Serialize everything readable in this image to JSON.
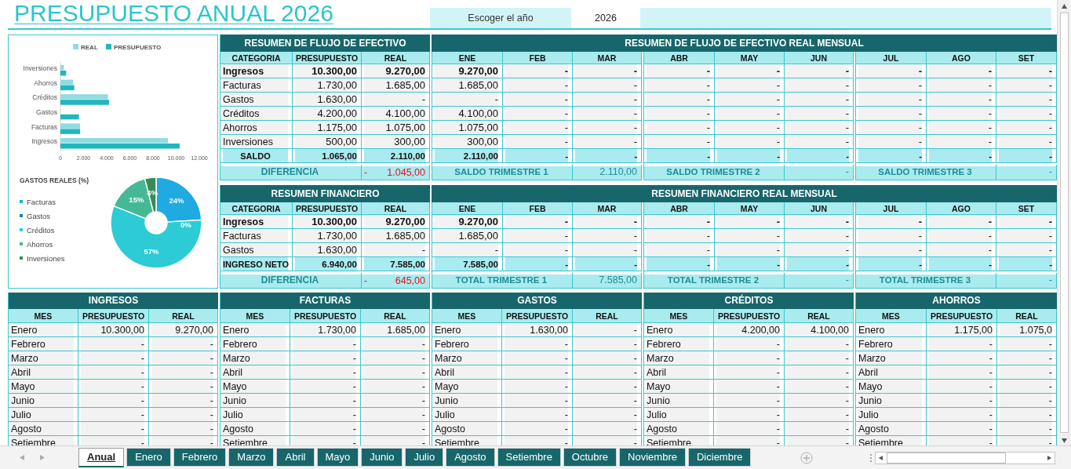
{
  "title": "PRESUPUESTO ANUAL 2026",
  "year_picker": {
    "label": "Escoger el año",
    "value": "2026"
  },
  "bar_chart": {
    "chart_data": {
      "type": "bar",
      "orientation": "horizontal",
      "legend": "top",
      "categories": [
        "Inversiones",
        "Ahorros",
        "Créditos",
        "Gastos",
        "Facturas",
        "Ingresos"
      ],
      "series": [
        {
          "name": "REAL",
          "color": "#8edde1",
          "values": [
            300,
            1100,
            4100,
            0,
            1700,
            9300
          ]
        },
        {
          "name": "PRESUPUESTO",
          "color": "#22b6bd",
          "values": [
            500,
            1200,
            4200,
            1600,
            1700,
            10300
          ]
        }
      ],
      "xlim": [
        0,
        12000
      ],
      "xticks": [
        {
          "value": 0,
          "label": "0"
        },
        {
          "value": 2000,
          "label": "2.000"
        },
        {
          "value": 4000,
          "label": "4.000"
        },
        {
          "value": 6000,
          "label": "6.000"
        },
        {
          "value": 8000,
          "label": "8.000"
        },
        {
          "value": 10000,
          "label": "10.000"
        },
        {
          "value": 12000,
          "label": "12.000"
        }
      ]
    }
  },
  "donut_chart": {
    "chart_data": {
      "type": "donut",
      "title": "GASTOS REALES (%)",
      "categories": [
        "Facturas",
        "Gastos",
        "Créditos",
        "Ahorros",
        "Inversiones"
      ],
      "values": [
        24,
        0,
        57,
        15,
        4
      ],
      "value_labels": [
        "24%",
        "0%",
        "57%",
        "15%",
        "4%"
      ]
    },
    "legend": [
      {
        "color": "#1faae2"
      },
      {
        "color": "#1e7db8"
      },
      {
        "color": "#2ccbd6"
      },
      {
        "color": "#45b996"
      },
      {
        "color": "#3a8a55"
      }
    ]
  },
  "cash_flow_summary": {
    "title": "RESUMEN DE FLUJO DE EFECTIVO",
    "columns": [
      "CATEGORIA",
      "PRESUPUESTO",
      "REAL"
    ],
    "rows": [
      {
        "kind": "income",
        "category": "Ingresos",
        "budget": "10.300,00",
        "real": "9.270,00"
      },
      {
        "kind": "item",
        "category": "Facturas",
        "budget": "1.730,00",
        "real": "1.685,00"
      },
      {
        "kind": "item",
        "category": "Gastos",
        "budget": "1.630,00",
        "real": "-"
      },
      {
        "kind": "item",
        "category": "Créditos",
        "budget": "4.200,00",
        "real": "4.100,00"
      },
      {
        "kind": "item",
        "category": "Ahorros",
        "budget": "1.175,00",
        "real": "1.075,00"
      },
      {
        "kind": "item",
        "category": "Inversiones",
        "budget": "500,00",
        "real": "300,00"
      },
      {
        "kind": "total",
        "category": "SALDO",
        "budget": "1.065,00",
        "real": "2.110,00"
      }
    ],
    "difference": {
      "label": "DIFERENCIA",
      "sign": "-",
      "value": "1.045,00"
    }
  },
  "cash_flow_monthly": {
    "title": "RESUMEN DE FLUJO DE EFECTIVO REAL MENSUAL",
    "quarters": [
      {
        "months": [
          "ENE",
          "FEB",
          "MAR"
        ],
        "rows": [
          [
            "9.270,00",
            "-",
            "-"
          ],
          [
            "1.685,00",
            "-",
            "-"
          ],
          [
            "-",
            "-",
            "-"
          ],
          [
            "4.100,00",
            "-",
            "-"
          ],
          [
            "1.075,00",
            "-",
            "-"
          ],
          [
            "300,00",
            "-",
            "-"
          ],
          [
            "2.110,00",
            "-",
            "-"
          ]
        ],
        "total_label": "SALDO TRIMESTRE 1",
        "total": "2.110,00"
      },
      {
        "months": [
          "ABR",
          "MAY",
          "JUN"
        ],
        "rows": [
          [
            "-",
            "-",
            "-"
          ],
          [
            "-",
            "-",
            "-"
          ],
          [
            "-",
            "-",
            "-"
          ],
          [
            "-",
            "-",
            "-"
          ],
          [
            "-",
            "-",
            "-"
          ],
          [
            "-",
            "-",
            "-"
          ],
          [
            "-",
            "-",
            "-"
          ]
        ],
        "total_label": "SALDO TRIMESTRE 2",
        "total": "-"
      },
      {
        "months": [
          "JUL",
          "AGO",
          "SET"
        ],
        "rows": [
          [
            "-",
            "-",
            "-"
          ],
          [
            "-",
            "-",
            "-"
          ],
          [
            "-",
            "-",
            "-"
          ],
          [
            "-",
            "-",
            "-"
          ],
          [
            "-",
            "-",
            "-"
          ],
          [
            "-",
            "-",
            "-"
          ],
          [
            "-",
            "-",
            "-"
          ]
        ],
        "total_label": "SALDO TRIMESTRE 3",
        "total": "-"
      }
    ]
  },
  "financial_summary": {
    "title": "RESUMEN FINANCIERO",
    "columns": [
      "CATEGORIA",
      "PRESUPUESTO",
      "REAL"
    ],
    "rows": [
      {
        "kind": "income",
        "category": "Ingresos",
        "budget": "10.300,00",
        "real": "9.270,00"
      },
      {
        "kind": "item",
        "category": "Facturas",
        "budget": "1.730,00",
        "real": "1.685,00"
      },
      {
        "kind": "item",
        "category": "Gastos",
        "budget": "1.630,00",
        "real": "-"
      },
      {
        "kind": "total",
        "category": "INGRESO NETO",
        "budget": "6.940,00",
        "real": "7.585,00"
      }
    ],
    "difference": {
      "label": "DIFERENCIA",
      "sign": "-",
      "value": "645,00"
    }
  },
  "financial_monthly": {
    "title": "RESUMEN FINANCIERO REAL MENSUAL",
    "quarters": [
      {
        "months": [
          "ENE",
          "FEB",
          "MAR"
        ],
        "rows": [
          [
            "9.270,00",
            "-",
            "-"
          ],
          [
            "1.685,00",
            "-",
            "-"
          ],
          [
            "-",
            "-",
            "-"
          ],
          [
            "7.585,00",
            "-",
            "-"
          ]
        ],
        "total_label": "TOTAL TRIMESTRE 1",
        "total": "7.585,00"
      },
      {
        "months": [
          "ABR",
          "MAY",
          "JUN"
        ],
        "rows": [
          [
            "-",
            "-",
            "-"
          ],
          [
            "-",
            "-",
            "-"
          ],
          [
            "-",
            "-",
            "-"
          ],
          [
            "-",
            "-",
            "-"
          ]
        ],
        "total_label": "TOTAL TRIMESTRE 2",
        "total": "-"
      },
      {
        "months": [
          "JUL",
          "AGO",
          "SET"
        ],
        "rows": [
          [
            "-",
            "-",
            "-"
          ],
          [
            "-",
            "-",
            "-"
          ],
          [
            "-",
            "-",
            "-"
          ],
          [
            "-",
            "-",
            "-"
          ]
        ],
        "total_label": "TOTAL TRIMESTRE 3",
        "total": "-"
      }
    ]
  },
  "category_tables": [
    {
      "title": "INGRESOS",
      "columns": [
        "MES",
        "PRESUPUESTO",
        "REAL"
      ],
      "rows": [
        [
          "Enero",
          "10.300,00",
          "9.270,00"
        ],
        [
          "Febrero",
          "-",
          "-"
        ],
        [
          "Marzo",
          "-",
          "-"
        ],
        [
          "Abril",
          "-",
          "-"
        ],
        [
          "Mayo",
          "-",
          "-"
        ],
        [
          "Junio",
          "-",
          "-"
        ],
        [
          "Julio",
          "-",
          "-"
        ],
        [
          "Agosto",
          "-",
          "-"
        ],
        [
          "Setiembre",
          "-",
          "-"
        ]
      ]
    },
    {
      "title": "FACTURAS",
      "columns": [
        "MES",
        "PRESUPUESTO",
        "REAL"
      ],
      "rows": [
        [
          "Enero",
          "1.730,00",
          "1.685,00"
        ],
        [
          "Febrero",
          "-",
          "-"
        ],
        [
          "Marzo",
          "-",
          "-"
        ],
        [
          "Abril",
          "-",
          "-"
        ],
        [
          "Mayo",
          "-",
          "-"
        ],
        [
          "Junio",
          "-",
          "-"
        ],
        [
          "Julio",
          "-",
          "-"
        ],
        [
          "Agosto",
          "-",
          "-"
        ],
        [
          "Setiembre",
          "-",
          "-"
        ]
      ]
    },
    {
      "title": "GASTOS",
      "columns": [
        "MES",
        "PRESUPUESTO",
        "REAL"
      ],
      "rows": [
        [
          "Enero",
          "1.630,00",
          "-"
        ],
        [
          "Febrero",
          "-",
          "-"
        ],
        [
          "Marzo",
          "-",
          "-"
        ],
        [
          "Abril",
          "-",
          "-"
        ],
        [
          "Mayo",
          "-",
          "-"
        ],
        [
          "Junio",
          "-",
          "-"
        ],
        [
          "Julio",
          "-",
          "-"
        ],
        [
          "Agosto",
          "-",
          "-"
        ],
        [
          "Setiembre",
          "-",
          "-"
        ]
      ]
    },
    {
      "title": "CRÉDITOS",
      "columns": [
        "MES",
        "PRESUPUESTO",
        "REAL"
      ],
      "rows": [
        [
          "Enero",
          "4.200,00",
          "4.100,00"
        ],
        [
          "Febrero",
          "-",
          "-"
        ],
        [
          "Marzo",
          "-",
          "-"
        ],
        [
          "Abril",
          "-",
          "-"
        ],
        [
          "Mayo",
          "-",
          "-"
        ],
        [
          "Junio",
          "-",
          "-"
        ],
        [
          "Julio",
          "-",
          "-"
        ],
        [
          "Agosto",
          "-",
          "-"
        ],
        [
          "Setiembre",
          "-",
          "-"
        ]
      ]
    },
    {
      "title": "AHORROS",
      "columns": [
        "MES",
        "PRESUPUESTO",
        "REAL"
      ],
      "rows": [
        [
          "Enero",
          "1.175,00",
          "1.075,0"
        ],
        [
          "Febrero",
          "-",
          "-"
        ],
        [
          "Marzo",
          "-",
          "-"
        ],
        [
          "Abril",
          "-",
          "-"
        ],
        [
          "Mayo",
          "-",
          "-"
        ],
        [
          "Junio",
          "-",
          "-"
        ],
        [
          "Julio",
          "-",
          "-"
        ],
        [
          "Agosto",
          "-",
          "-"
        ],
        [
          "Setiembre",
          "-",
          "-"
        ]
      ]
    }
  ],
  "sheet_tabs": [
    {
      "label": "Anual",
      "selected": true
    },
    {
      "label": "Enero",
      "selected": false
    },
    {
      "label": "Febrero",
      "selected": false
    },
    {
      "label": "Marzo",
      "selected": false
    },
    {
      "label": "Abril",
      "selected": false
    },
    {
      "label": "Mayo",
      "selected": false
    },
    {
      "label": "Junio",
      "selected": false
    },
    {
      "label": "Julio",
      "selected": false
    },
    {
      "label": "Agosto",
      "selected": false
    },
    {
      "label": "Setiembre",
      "selected": false
    },
    {
      "label": "Octubre",
      "selected": false
    },
    {
      "label": "Noviembre",
      "selected": false
    },
    {
      "label": "Diciembre",
      "selected": false
    }
  ]
}
